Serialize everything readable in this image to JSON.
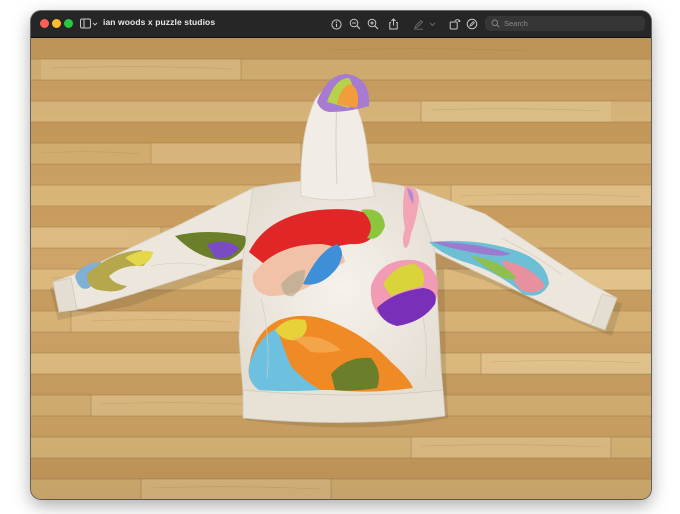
{
  "window": {
    "title": "ian woods x puzzle studios"
  },
  "toolbar": {
    "sidebar_toggle_icon": "sidebar-icon",
    "info_icon": "info-icon",
    "zoom_out_icon": "zoom-out-icon",
    "zoom_in_icon": "zoom-in-icon",
    "share_icon": "share-icon",
    "markup_icon": "pen-icon",
    "rotate_icon": "rotate-icon",
    "annotate_icon": "markup-circle-icon",
    "search_icon": "search-icon",
    "search_placeholder": "Search"
  },
  "colors": {
    "titlebar": "#262626",
    "close": "#ff5f57",
    "minimize": "#febc2e",
    "maximize": "#28c840",
    "floor": "#d2a868",
    "hoodie": "#efeae2"
  }
}
